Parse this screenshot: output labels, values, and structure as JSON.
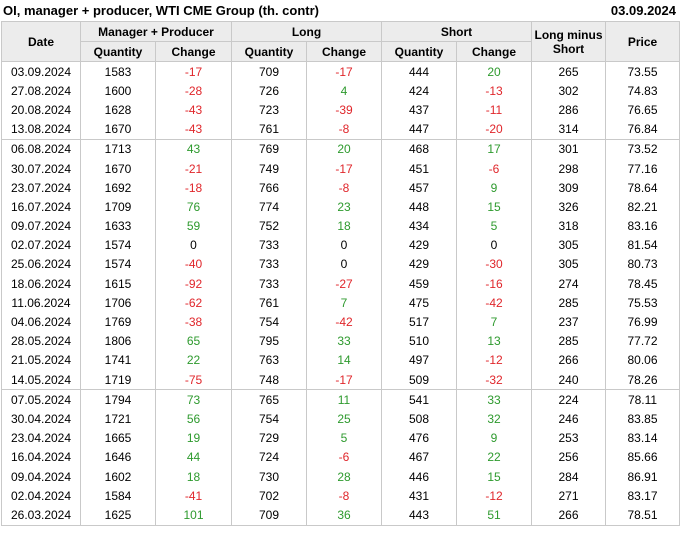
{
  "header": {
    "title": "OI, manager + producer, WTI CME Group (th. contr)",
    "date": "03.09.2024"
  },
  "columns": {
    "date": "Date",
    "mp": "Manager + Producer",
    "long": "Long",
    "short": "Short",
    "lms": "Long minus Short",
    "price": "Price",
    "quantity": "Quantity",
    "change": "Change"
  },
  "rows": [
    {
      "date": "03.09.2024",
      "mp_q": "1583",
      "mp_c": "-17",
      "l_q": "709",
      "l_c": "-17",
      "s_q": "444",
      "s_c": "20",
      "lms": "265",
      "price": "73.55",
      "sep": false
    },
    {
      "date": "27.08.2024",
      "mp_q": "1600",
      "mp_c": "-28",
      "l_q": "726",
      "l_c": "4",
      "s_q": "424",
      "s_c": "-13",
      "lms": "302",
      "price": "74.83",
      "sep": false
    },
    {
      "date": "20.08.2024",
      "mp_q": "1628",
      "mp_c": "-43",
      "l_q": "723",
      "l_c": "-39",
      "s_q": "437",
      "s_c": "-11",
      "lms": "286",
      "price": "76.65",
      "sep": false
    },
    {
      "date": "13.08.2024",
      "mp_q": "1670",
      "mp_c": "-43",
      "l_q": "761",
      "l_c": "-8",
      "s_q": "447",
      "s_c": "-20",
      "lms": "314",
      "price": "76.84",
      "sep": false
    },
    {
      "date": "06.08.2024",
      "mp_q": "1713",
      "mp_c": "43",
      "l_q": "769",
      "l_c": "20",
      "s_q": "468",
      "s_c": "17",
      "lms": "301",
      "price": "73.52",
      "sep": true
    },
    {
      "date": "30.07.2024",
      "mp_q": "1670",
      "mp_c": "-21",
      "l_q": "749",
      "l_c": "-17",
      "s_q": "451",
      "s_c": "-6",
      "lms": "298",
      "price": "77.16",
      "sep": false
    },
    {
      "date": "23.07.2024",
      "mp_q": "1692",
      "mp_c": "-18",
      "l_q": "766",
      "l_c": "-8",
      "s_q": "457",
      "s_c": "9",
      "lms": "309",
      "price": "78.64",
      "sep": false
    },
    {
      "date": "16.07.2024",
      "mp_q": "1709",
      "mp_c": "76",
      "l_q": "774",
      "l_c": "23",
      "s_q": "448",
      "s_c": "15",
      "lms": "326",
      "price": "82.21",
      "sep": false
    },
    {
      "date": "09.07.2024",
      "mp_q": "1633",
      "mp_c": "59",
      "l_q": "752",
      "l_c": "18",
      "s_q": "434",
      "s_c": "5",
      "lms": "318",
      "price": "83.16",
      "sep": false
    },
    {
      "date": "02.07.2024",
      "mp_q": "1574",
      "mp_c": "0",
      "l_q": "733",
      "l_c": "0",
      "s_q": "429",
      "s_c": "0",
      "lms": "305",
      "price": "81.54",
      "sep": false
    },
    {
      "date": "25.06.2024",
      "mp_q": "1574",
      "mp_c": "-40",
      "l_q": "733",
      "l_c": "0",
      "s_q": "429",
      "s_c": "-30",
      "lms": "305",
      "price": "80.73",
      "sep": false
    },
    {
      "date": "18.06.2024",
      "mp_q": "1615",
      "mp_c": "-92",
      "l_q": "733",
      "l_c": "-27",
      "s_q": "459",
      "s_c": "-16",
      "lms": "274",
      "price": "78.45",
      "sep": false
    },
    {
      "date": "11.06.2024",
      "mp_q": "1706",
      "mp_c": "-62",
      "l_q": "761",
      "l_c": "7",
      "s_q": "475",
      "s_c": "-42",
      "lms": "285",
      "price": "75.53",
      "sep": false
    },
    {
      "date": "04.06.2024",
      "mp_q": "1769",
      "mp_c": "-38",
      "l_q": "754",
      "l_c": "-42",
      "s_q": "517",
      "s_c": "7",
      "lms": "237",
      "price": "76.99",
      "sep": false
    },
    {
      "date": "28.05.2024",
      "mp_q": "1806",
      "mp_c": "65",
      "l_q": "795",
      "l_c": "33",
      "s_q": "510",
      "s_c": "13",
      "lms": "285",
      "price": "77.72",
      "sep": false
    },
    {
      "date": "21.05.2024",
      "mp_q": "1741",
      "mp_c": "22",
      "l_q": "763",
      "l_c": "14",
      "s_q": "497",
      "s_c": "-12",
      "lms": "266",
      "price": "80.06",
      "sep": false
    },
    {
      "date": "14.05.2024",
      "mp_q": "1719",
      "mp_c": "-75",
      "l_q": "748",
      "l_c": "-17",
      "s_q": "509",
      "s_c": "-32",
      "lms": "240",
      "price": "78.26",
      "sep": false
    },
    {
      "date": "07.05.2024",
      "mp_q": "1794",
      "mp_c": "73",
      "l_q": "765",
      "l_c": "11",
      "s_q": "541",
      "s_c": "33",
      "lms": "224",
      "price": "78.11",
      "sep": true
    },
    {
      "date": "30.04.2024",
      "mp_q": "1721",
      "mp_c": "56",
      "l_q": "754",
      "l_c": "25",
      "s_q": "508",
      "s_c": "32",
      "lms": "246",
      "price": "83.85",
      "sep": false
    },
    {
      "date": "23.04.2024",
      "mp_q": "1665",
      "mp_c": "19",
      "l_q": "729",
      "l_c": "5",
      "s_q": "476",
      "s_c": "9",
      "lms": "253",
      "price": "83.14",
      "sep": false
    },
    {
      "date": "16.04.2024",
      "mp_q": "1646",
      "mp_c": "44",
      "l_q": "724",
      "l_c": "-6",
      "s_q": "467",
      "s_c": "22",
      "lms": "256",
      "price": "85.66",
      "sep": false
    },
    {
      "date": "09.04.2024",
      "mp_q": "1602",
      "mp_c": "18",
      "l_q": "730",
      "l_c": "28",
      "s_q": "446",
      "s_c": "15",
      "lms": "284",
      "price": "86.91",
      "sep": false
    },
    {
      "date": "02.04.2024",
      "mp_q": "1584",
      "mp_c": "-41",
      "l_q": "702",
      "l_c": "-8",
      "s_q": "431",
      "s_c": "-12",
      "lms": "271",
      "price": "83.17",
      "sep": false
    },
    {
      "date": "26.03.2024",
      "mp_q": "1625",
      "mp_c": "101",
      "l_q": "709",
      "l_c": "36",
      "s_q": "443",
      "s_c": "51",
      "lms": "266",
      "price": "78.51",
      "sep": false
    }
  ],
  "colors": {
    "positive": "#2e9a2e",
    "negative": "#e0262b",
    "header_bg": "#ececec",
    "grid": "#c9c9c9"
  }
}
